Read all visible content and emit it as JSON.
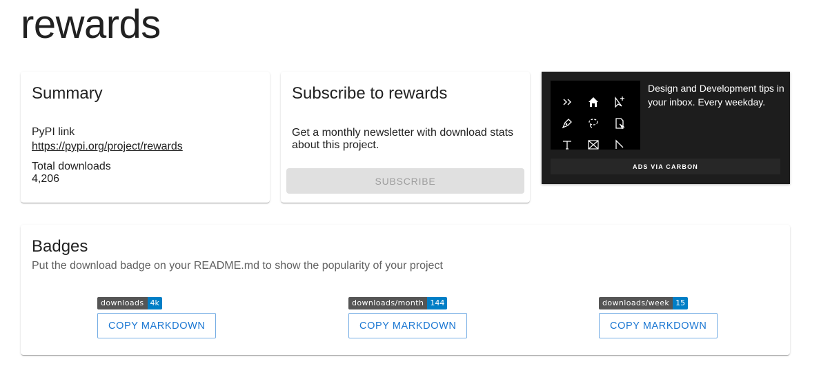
{
  "page": {
    "title": "rewards"
  },
  "summary": {
    "title": "Summary",
    "pypi_label": "PyPI link",
    "pypi_url": "https://pypi.org/project/rewards",
    "downloads_label": "Total downloads",
    "downloads_value": "4,206"
  },
  "subscribe": {
    "title": "Subscribe to rewards",
    "description": "Get a monthly newsletter with download stats about this project.",
    "button_label": "SUBSCRIBE"
  },
  "ad": {
    "text": "Design and Development tips in your inbox. Every weekday.",
    "via_label": "ADS VIA CARBON",
    "icons": [
      "chevrons-icon",
      "home-icon",
      "cursor-plus-icon",
      "pen-icon",
      "lasso-icon",
      "file-arrow-icon",
      "text-tool-icon",
      "frame-icon",
      "angle-icon"
    ]
  },
  "badges": {
    "title": "Badges",
    "subtitle": "Put the download badge on your README.md to show the popularity of your project",
    "items": [
      {
        "label": "downloads",
        "value": "4k",
        "button": "COPY MARKDOWN"
      },
      {
        "label": "downloads/month",
        "value": "144",
        "button": "COPY MARKDOWN"
      },
      {
        "label": "downloads/week",
        "value": "15",
        "button": "COPY MARKDOWN"
      }
    ]
  },
  "colors": {
    "badge_dark": "#555555",
    "badge_blue": "#007ec6",
    "primary": "#1976d2",
    "ad_bg": "#1d1d1d"
  }
}
